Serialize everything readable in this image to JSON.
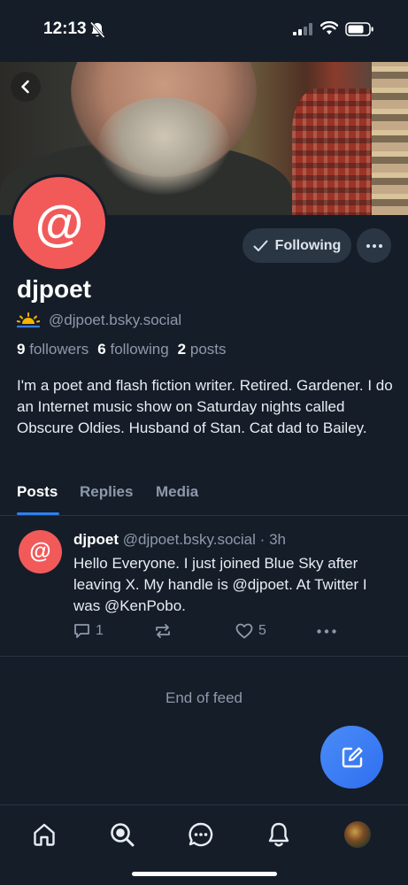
{
  "status_bar": {
    "time": "12:13",
    "icons": [
      "bell-slash-icon",
      "cellular-signal-icon",
      "wifi-icon",
      "battery-icon"
    ]
  },
  "header": {
    "back_icon": "chevron-left-icon"
  },
  "profile": {
    "display_name": "djpoet",
    "handle": "@djpoet.bsky.social",
    "avatar_glyph": "@",
    "following_label": "Following",
    "following_icon": "check-icon",
    "more_icon": "ellipsis-icon",
    "stats": {
      "followers_count": "9",
      "followers_label": "followers",
      "following_count": "6",
      "following_label": "following",
      "posts_count": "2",
      "posts_label": "posts"
    },
    "bio": "I'm a poet and flash fiction writer.  Retired.  Gardener.  I do an Internet music show on Saturday nights called Obscure Oldies.  Husband of Stan.  Cat dad to Bailey."
  },
  "tabs": [
    {
      "label": "Posts",
      "active": true
    },
    {
      "label": "Replies",
      "active": false
    },
    {
      "label": "Media",
      "active": false
    }
  ],
  "feed": {
    "posts": [
      {
        "author": "djpoet",
        "handle": "@djpoet.bsky.social",
        "separator": "·",
        "time": "3h",
        "text": "Hello Everyone.  I just joined Blue Sky after leaving X.  My handle is @djpoet.  At Twitter I was @KenPobo.",
        "replies": "1",
        "likes": "5"
      }
    ],
    "end_label": "End of feed"
  },
  "compose": {
    "icon": "compose-icon"
  },
  "bottom_nav": [
    {
      "name": "home",
      "icon": "home-icon"
    },
    {
      "name": "search",
      "icon": "search-icon"
    },
    {
      "name": "chat",
      "icon": "chat-icon"
    },
    {
      "name": "notifications",
      "icon": "bell-icon"
    },
    {
      "name": "profile",
      "icon": "profile-avatar"
    }
  ],
  "colors": {
    "background": "#151d28",
    "accent": "#2f80ed",
    "avatar": "#f25a5a",
    "muted_text": "#8d99aa"
  }
}
